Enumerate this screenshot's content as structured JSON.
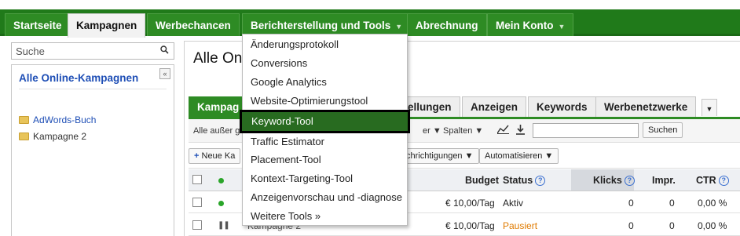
{
  "nav": {
    "tabs": [
      {
        "label": "Startseite"
      },
      {
        "label": "Kampagnen"
      },
      {
        "label": "Werbechancen"
      },
      {
        "label": "Berichterstellung und Tools",
        "caret": "▼"
      },
      {
        "label": "Abrechnung"
      },
      {
        "label": "Mein Konto",
        "caret": "▼"
      }
    ]
  },
  "sidebar": {
    "search_placeholder": "Suche",
    "search_icon": "magnifier-icon",
    "collapse_glyph": "«",
    "header": "Alle Online-Kampagnen",
    "campaigns": [
      {
        "label": "AdWords-Buch"
      },
      {
        "label": "Kampagne 2"
      }
    ]
  },
  "main": {
    "title": "Alle Onl",
    "subtabs": [
      {
        "label": "Kampag"
      },
      {
        "label": "ellungen"
      },
      {
        "label": "Anzeigen"
      },
      {
        "label": "Keywords"
      },
      {
        "label": "Werbenetzwerke"
      },
      {
        "label": "▼"
      }
    ],
    "toolbar": {
      "filter_text": "Alle außer g",
      "columns_label": "Spalten ▼",
      "segment_suffix": "er ▼",
      "search_button": "Suchen"
    },
    "actions": {
      "new_label": "Neue Ka",
      "notifications_label": "chrichtigungen ▼",
      "automate_label": "Automatisieren ▼"
    },
    "table": {
      "headers": {
        "budget": "Budget",
        "status": "Status",
        "klicks": "Klicks",
        "impr": "Impr.",
        "ctr": "CTR"
      },
      "rows": [
        {
          "name": "",
          "budget": "€ 10,00/Tag",
          "status": "Aktiv",
          "klicks": "0",
          "impr": "0",
          "ctr": "0,00 %"
        },
        {
          "name": "Kampagne 2",
          "budget": "€ 10,00/Tag",
          "status": "Pausiert",
          "klicks": "0",
          "impr": "0",
          "ctr": "0,00 %"
        }
      ]
    }
  },
  "dropdown": {
    "items": [
      {
        "label": "Änderungsprotokoll"
      },
      {
        "label": "Conversions"
      },
      {
        "label": "Google Analytics"
      },
      {
        "label": "Website-Optimierungstool"
      },
      {
        "label": "Keyword-Tool"
      },
      {
        "label": "Traffic Estimator"
      },
      {
        "label": "Placement-Tool"
      },
      {
        "label": "Kontext-Targeting-Tool"
      },
      {
        "label": "Anzeigenvorschau und -diagnose"
      },
      {
        "label": "Weitere Tools »"
      }
    ]
  },
  "colors": {
    "nav_green": "#207a1a",
    "highlight_green": "#286b20",
    "link_blue": "#1f4fb6",
    "paused_orange": "#e07b00",
    "active_dot": "#2aa52a"
  }
}
